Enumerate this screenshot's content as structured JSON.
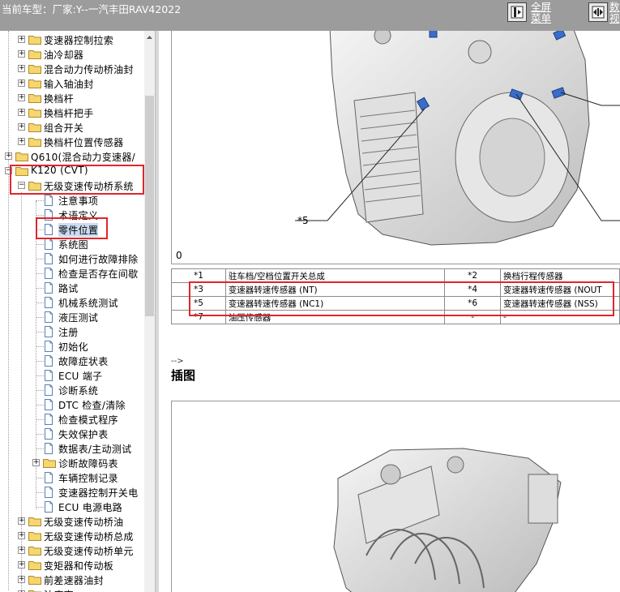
{
  "header": {
    "vehicle_label": "当前车型：",
    "vehicle_value": "厂家:Y--一汽丰田RAV42022",
    "fullscreen_line1": "全屏",
    "fullscreen_line2": "菜单",
    "second_link": "数",
    "second_link_line2": "视"
  },
  "tree": {
    "items": [
      {
        "label": "变速器控制拉索",
        "type": "folder",
        "level": 2,
        "expand": "+"
      },
      {
        "label": "油冷却器",
        "type": "folder",
        "level": 2,
        "expand": "+"
      },
      {
        "label": "混合动力传动桥油封",
        "type": "folder",
        "level": 2,
        "expand": "+"
      },
      {
        "label": "输入轴油封",
        "type": "folder",
        "level": 2,
        "expand": "+"
      },
      {
        "label": "换档杆",
        "type": "folder",
        "level": 2,
        "expand": "+"
      },
      {
        "label": "换档杆把手",
        "type": "folder",
        "level": 2,
        "expand": "+"
      },
      {
        "label": "组合开关",
        "type": "folder",
        "level": 2,
        "expand": "+"
      },
      {
        "label": "换档杆位置传感器",
        "type": "folder",
        "level": 2,
        "expand": "+"
      },
      {
        "label": "Q610(混合动力变速器/",
        "type": "folder",
        "level": 1,
        "expand": "+"
      },
      {
        "label": "K120 (CVT)",
        "type": "folder",
        "level": 1,
        "expand": "-"
      },
      {
        "label": "无级变速传动桥系统",
        "type": "folder",
        "level": 2,
        "expand": "-"
      },
      {
        "label": "注意事项",
        "type": "doc",
        "level": 3
      },
      {
        "label": "术语定义",
        "type": "doc",
        "level": 3
      },
      {
        "label": "零件位置",
        "type": "doc",
        "level": 3,
        "selected": true
      },
      {
        "label": "系统图",
        "type": "doc",
        "level": 3
      },
      {
        "label": "如何进行故障排除",
        "type": "doc",
        "level": 3
      },
      {
        "label": "检查是否存在间歇",
        "type": "doc",
        "level": 3
      },
      {
        "label": "路试",
        "type": "doc",
        "level": 3
      },
      {
        "label": "机械系统测试",
        "type": "doc",
        "level": 3
      },
      {
        "label": "液压测试",
        "type": "doc",
        "level": 3
      },
      {
        "label": "注册",
        "type": "doc",
        "level": 3
      },
      {
        "label": "初始化",
        "type": "doc",
        "level": 3
      },
      {
        "label": "故障症状表",
        "type": "doc",
        "level": 3
      },
      {
        "label": "ECU 端子",
        "type": "doc",
        "level": 3
      },
      {
        "label": "诊断系统",
        "type": "doc",
        "level": 3
      },
      {
        "label": "DTC 检查/清除",
        "type": "doc",
        "level": 3
      },
      {
        "label": "检查模式程序",
        "type": "doc",
        "level": 3
      },
      {
        "label": "失效保护表",
        "type": "doc",
        "level": 3
      },
      {
        "label": "数据表/主动测试",
        "type": "doc",
        "level": 3
      },
      {
        "label": "诊断故障码表",
        "type": "folder",
        "level": 3,
        "expand": "+"
      },
      {
        "label": "车辆控制记录",
        "type": "doc",
        "level": 3
      },
      {
        "label": "变速器控制开关电",
        "type": "doc",
        "level": 3
      },
      {
        "label": "ECU 电源电路",
        "type": "doc",
        "level": 3
      },
      {
        "label": "无级变速传动桥油",
        "type": "folder",
        "level": 2,
        "expand": "+"
      },
      {
        "label": "无级变速传动桥总成",
        "type": "folder",
        "level": 2,
        "expand": "+"
      },
      {
        "label": "无级变速传动桥单元",
        "type": "folder",
        "level": 2,
        "expand": "+"
      },
      {
        "label": "变矩器和传动板",
        "type": "folder",
        "level": 2,
        "expand": "+"
      },
      {
        "label": "前差速器油封",
        "type": "folder",
        "level": 2,
        "expand": "+"
      },
      {
        "label": "油底壳",
        "type": "folder",
        "level": 2,
        "expand": "+"
      }
    ]
  },
  "content": {
    "callout_5": "*5",
    "image_id": "0",
    "parts_table": [
      {
        "n1": "*1",
        "d1": "驻车档/空档位置开关总成",
        "n2": "*2",
        "d2": "换档行程传感器"
      },
      {
        "n1": "*3",
        "d1": "变速器转速传感器 (NT)",
        "n2": "*4",
        "d2": "变速器转速传感器 (NOUT"
      },
      {
        "n1": "*5",
        "d1": "变速器转速传感器 (NC1)",
        "n2": "*6",
        "d2": "变速器转速传感器 (NSS)"
      },
      {
        "n1": "*7",
        "d1": "油压传感器",
        "n2": "-",
        "d2": "-"
      }
    ],
    "comment_arrow": "-->",
    "section_heading": "插图"
  },
  "colors": {
    "topbar": "#9c9c9c",
    "highlight_red": "#e0262b",
    "selected_bg": "#cbdcf2",
    "folder_yellow": "#f6d66f"
  }
}
